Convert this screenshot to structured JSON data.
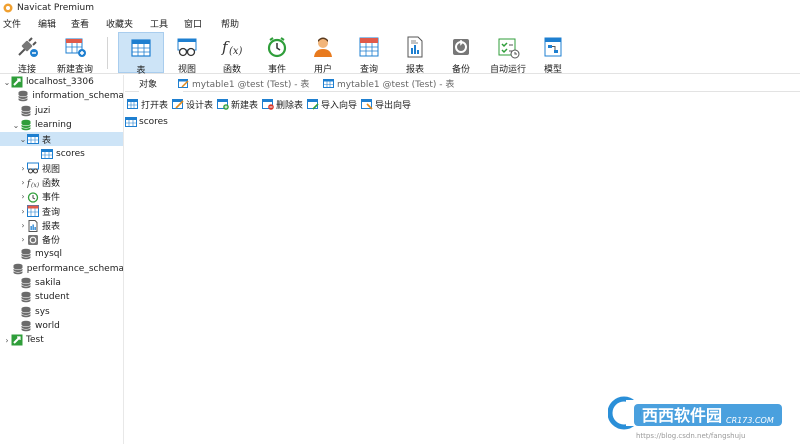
{
  "window": {
    "title": "Navicat Premium"
  },
  "menu": [
    "文件",
    "编辑",
    "查看",
    "收藏夹",
    "工具",
    "窗口",
    "帮助"
  ],
  "toolbar": {
    "buttons": [
      {
        "label": "连接",
        "icon": "connection-icon"
      },
      {
        "label": "新建查询",
        "icon": "new-query-icon"
      },
      {
        "label": "表",
        "icon": "table-icon",
        "active": true
      },
      {
        "label": "视图",
        "icon": "view-icon"
      },
      {
        "label": "函数",
        "icon": "function-icon"
      },
      {
        "label": "事件",
        "icon": "event-clock-icon"
      },
      {
        "label": "用户",
        "icon": "user-icon"
      },
      {
        "label": "查询",
        "icon": "query-icon"
      },
      {
        "label": "报表",
        "icon": "report-icon"
      },
      {
        "label": "备份",
        "icon": "backup-icon"
      },
      {
        "label": "自动运行",
        "icon": "auto-run-icon"
      },
      {
        "label": "模型",
        "icon": "model-icon"
      }
    ]
  },
  "tree": {
    "items": [
      {
        "label": "localhost_3306",
        "icon": "connection-green-icon",
        "chev": "⌄",
        "level": 0
      },
      {
        "label": "information_schema",
        "icon": "database-icon",
        "chev": "",
        "level": 1
      },
      {
        "label": "juzi",
        "icon": "database-icon",
        "chev": "",
        "level": 1
      },
      {
        "label": "learning",
        "icon": "database-open-icon",
        "chev": "⌄",
        "level": 1
      },
      {
        "label": "表",
        "icon": "table-icon",
        "chev": "⌄",
        "level": 2,
        "selected": true
      },
      {
        "label": "scores",
        "icon": "table-icon",
        "chev": "",
        "level": 3
      },
      {
        "label": "视图",
        "icon": "view-icon",
        "chev": "›",
        "level": 2
      },
      {
        "label": "函数",
        "icon": "function-icon",
        "chev": "›",
        "level": 2
      },
      {
        "label": "事件",
        "icon": "event-clock-icon",
        "chev": "›",
        "level": 2
      },
      {
        "label": "查询",
        "icon": "query-icon",
        "chev": "›",
        "level": 2
      },
      {
        "label": "报表",
        "icon": "report-icon",
        "chev": "›",
        "level": 2
      },
      {
        "label": "备份",
        "icon": "backup-icon",
        "chev": "›",
        "level": 2
      },
      {
        "label": "mysql",
        "icon": "database-icon",
        "chev": "",
        "level": 1
      },
      {
        "label": "performance_schema",
        "icon": "database-icon",
        "chev": "",
        "level": 1
      },
      {
        "label": "sakila",
        "icon": "database-icon",
        "chev": "",
        "level": 1
      },
      {
        "label": "student",
        "icon": "database-icon",
        "chev": "",
        "level": 1
      },
      {
        "label": "sys",
        "icon": "database-icon",
        "chev": "",
        "level": 1
      },
      {
        "label": "world",
        "icon": "database-icon",
        "chev": "",
        "level": 1
      },
      {
        "label": "Test",
        "icon": "connection-green-icon",
        "chev": "›",
        "level": 0
      }
    ]
  },
  "tabs": [
    {
      "label": "对象",
      "active": true
    },
    {
      "label": "mytable1 @test (Test) - 表",
      "active": false
    },
    {
      "label": "mytable1 @test (Test) - 表",
      "active": false
    }
  ],
  "object_toolbar": [
    "打开表",
    "设计表",
    "新建表",
    "删除表",
    "导入向导",
    "导出向导"
  ],
  "objects": [
    "scores"
  ],
  "watermark": {
    "text": "西西软件园",
    "brand": "CR173.COM",
    "url": "https://blog.csdn.net/fangshuju"
  },
  "colors": {
    "selection": "#cde4f7",
    "accent": "#1e7fd0",
    "db_gray": "#6b6b6b",
    "conn_green": "#2f9e3a"
  }
}
